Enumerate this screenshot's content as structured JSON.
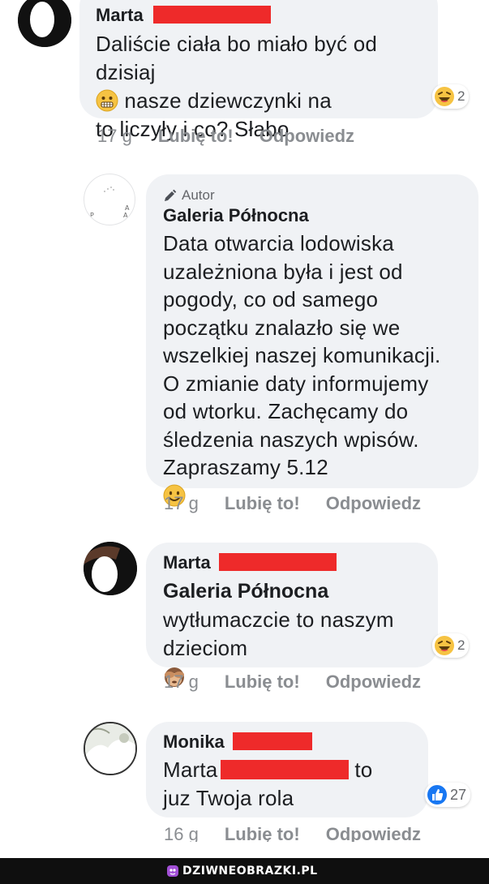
{
  "comments": [
    {
      "author": "Marta",
      "text": "Daliście ciała bo miało być od\ndzisiaj",
      "text_after_emoji": " nasze dziewczynki na\nto liczyły i co? Słabo",
      "time": "17 g",
      "like": "Lubię to!",
      "reply": "Odpowiedz",
      "reaction_count": "2",
      "reaction_icon": "laughing-emoji"
    },
    {
      "badge": "Autor",
      "author": "Galeria Północna",
      "text": "Data otwarcia lodowiska\nuzależniona była i jest od\npogody, co od samego\npoczątku znalazło się we\nwszelkiej naszej komunikacji.\nO zmianie daty informujemy\nod wtorku. Zachęcamy do\nśledzenia naszych wpisów.\nZapraszamy 5.12",
      "time": "17 g",
      "like": "Lubię to!",
      "reply": "Odpowiedz",
      "avatar_letters": [
        "A",
        "P",
        "A"
      ]
    },
    {
      "author": "Marta",
      "mention": "Galeria Północna",
      "text": "wytłumaczcie to naszym\ndzieciom",
      "time": "17 g",
      "like": "Lubię to!",
      "reply": "Odpowiedz",
      "reaction_count": "2",
      "reaction_icon": "laughing-emoji"
    },
    {
      "author": "Monika",
      "mention_prefix": "Marta",
      "mention_suffix": " to",
      "text": "juz Twoja rola",
      "time": "16 g",
      "like": "Lubię to!",
      "reply": "Odpowiedz",
      "reaction_count": "27",
      "reaction_icon": "like-thumb"
    }
  ],
  "footer": {
    "site": "DZIWNEOBRAZKI.PL"
  },
  "colors": {
    "bubble": "#f0f2f5",
    "redaction": "#ee2a2a",
    "meta": "#8a8d91",
    "like_blue": "#1877f2"
  }
}
